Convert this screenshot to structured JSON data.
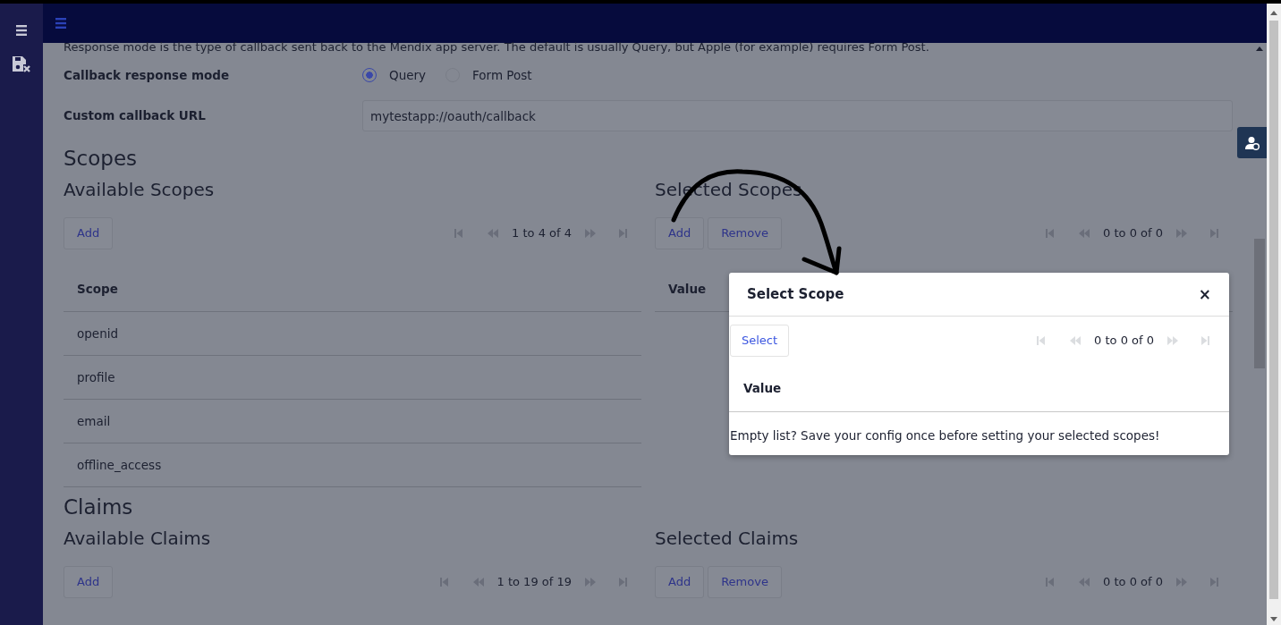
{
  "description": "Response mode is the type of callback sent back to the Mendix app server. The default is usually Query, but Apple (for example) requires Form Post.",
  "fields": [
    {
      "kind": "radio",
      "label": "Callback response mode",
      "options": [
        {
          "label": "Query",
          "selected": true
        },
        {
          "label": "Form Post",
          "selected": false
        }
      ]
    },
    {
      "kind": "text",
      "label": "Custom callback URL",
      "value": "mytestapp://oauth/callback"
    }
  ],
  "sections": [
    {
      "title": "Scopes",
      "panels": [
        {
          "title": "Available Scopes",
          "buttons": [
            "Add"
          ],
          "pager": "1 to 4 of 4",
          "columns": [
            "Scope"
          ],
          "rows": [
            "openid",
            "profile",
            "email",
            "offline_access"
          ]
        },
        {
          "title": "Selected Scopes",
          "buttons": [
            "Add",
            "Remove"
          ],
          "pager": "0 to 0 of 0",
          "columns": [
            "Value"
          ]
        }
      ]
    },
    {
      "title": "Claims",
      "panels": [
        {
          "title": "Available Claims",
          "buttons": [
            "Add"
          ],
          "pager": "1 to 19 of 19"
        },
        {
          "title": "Selected Claims",
          "buttons": [
            "Add",
            "Remove"
          ],
          "pager": "0 to 0 of 0"
        }
      ]
    }
  ],
  "modal": {
    "title": "Select Scope",
    "close": "×",
    "buttons": [
      "Select"
    ],
    "pager": "0 to 0 of 0",
    "columns": [
      "Value"
    ],
    "message": "Empty list? Save your config once before setting your selected scopes!"
  }
}
